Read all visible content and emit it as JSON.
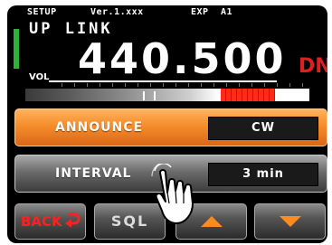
{
  "status": {
    "mode": "SETUP",
    "version": "Ver.1.xxx",
    "exp": "EXP",
    "channel_tag": "A1"
  },
  "display": {
    "band_name": "UP LINK",
    "volume_label": "VOL",
    "frequency": "440.500",
    "shift_direction": "DN",
    "vfo_indicator_color": "#29b53a"
  },
  "menu": {
    "announce": {
      "label": "ANNOUNCE",
      "value": "CW",
      "color": "#f58d2b"
    },
    "interval": {
      "label": "INTERVAL",
      "value": "3 min",
      "color": "#6b6b6b"
    }
  },
  "softkeys": {
    "back": {
      "label": "BACK",
      "icon": "return-arrow-icon"
    },
    "sql": {
      "label": "SQL"
    },
    "up": {
      "icon": "triangle-up-icon"
    },
    "down": {
      "icon": "triangle-down-icon"
    }
  },
  "overlay": {
    "pointer_icon": "tapping-hand-icon"
  },
  "colors": {
    "accent_orange": "#ff8a1f",
    "alert_red": "#e02020"
  }
}
